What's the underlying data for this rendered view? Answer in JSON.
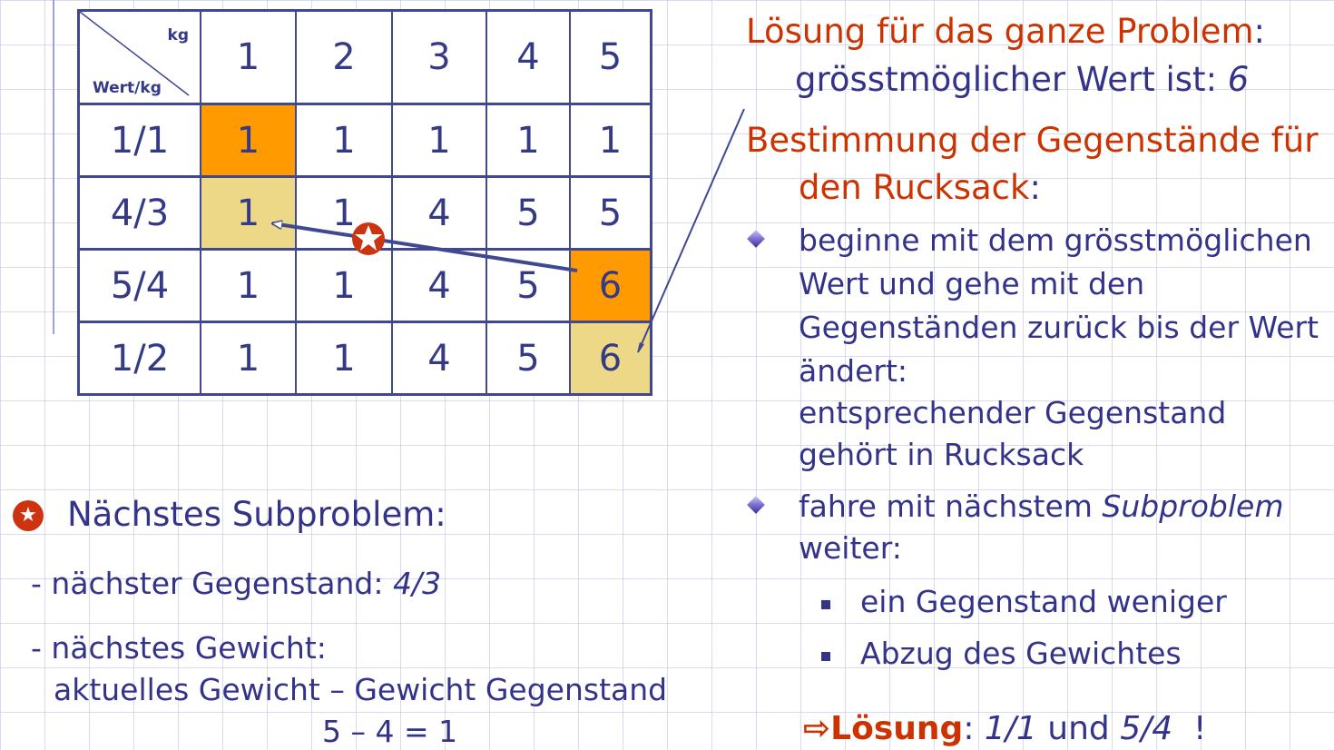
{
  "table": {
    "corner_top": "kg",
    "corner_bottom": "Wert/kg",
    "col_headers": [
      "1",
      "2",
      "3",
      "4",
      "5"
    ],
    "rows": [
      {
        "label": "1/1",
        "cells": [
          "1",
          "1",
          "1",
          "1",
          "1"
        ]
      },
      {
        "label": "4/3",
        "cells": [
          "1",
          "1",
          "4",
          "5",
          "5"
        ]
      },
      {
        "label": "5/4",
        "cells": [
          "1",
          "1",
          "4",
          "5",
          "6"
        ]
      },
      {
        "label": "1/2",
        "cells": [
          "1",
          "1",
          "4",
          "5",
          "6"
        ]
      }
    ],
    "highlight_colors": {
      "orange": "#ff9a00",
      "tan": "#ecd887"
    }
  },
  "star_icon": "red-star-icon",
  "left": {
    "title": "Nächstes Subproblem:",
    "item1_prefix": "- nächster Gegenstand: ",
    "item1_value": "4/3",
    "item2": "- nächstes Gewicht:",
    "item2_line2": "aktuelles Gewicht  – Gewicht Gegenstand",
    "item2_line3": "5 – 4 = 1"
  },
  "right": {
    "heading1": "Lösung für das ganze Problem",
    "heading1_colon": ":",
    "line2_text": "grösstmöglicher Wert ist: ",
    "line2_value": "6",
    "heading2_line1": "Bestimmung der Gegenstände für",
    "heading2_line2": "den Rucksack",
    "heading2_colon": ":",
    "bullet1": [
      "beginne mit dem grösstmöglichen",
      "Wert und gehe mit den",
      "Gegenständen zurück bis der Wert",
      "ändert:",
      "entsprechender Gegenstand",
      "gehört in Rucksack"
    ],
    "bullet2_prefix": "fahre mit nächstem ",
    "bullet2_italic": "Subproblem",
    "bullet2_line2": "weiter:",
    "sub1": "ein Gegenstand weniger",
    "sub2": "Abzug des Gewichtes",
    "solution_arrow": "⇨",
    "solution_label": "Lösung",
    "solution_colon": ": ",
    "solution_v1": "1/1",
    "solution_und": " und ",
    "solution_v2": "5/4",
    "solution_excl": "  !"
  },
  "colors": {
    "accent_red": "#cc3300",
    "text_blue": "#33338a"
  }
}
